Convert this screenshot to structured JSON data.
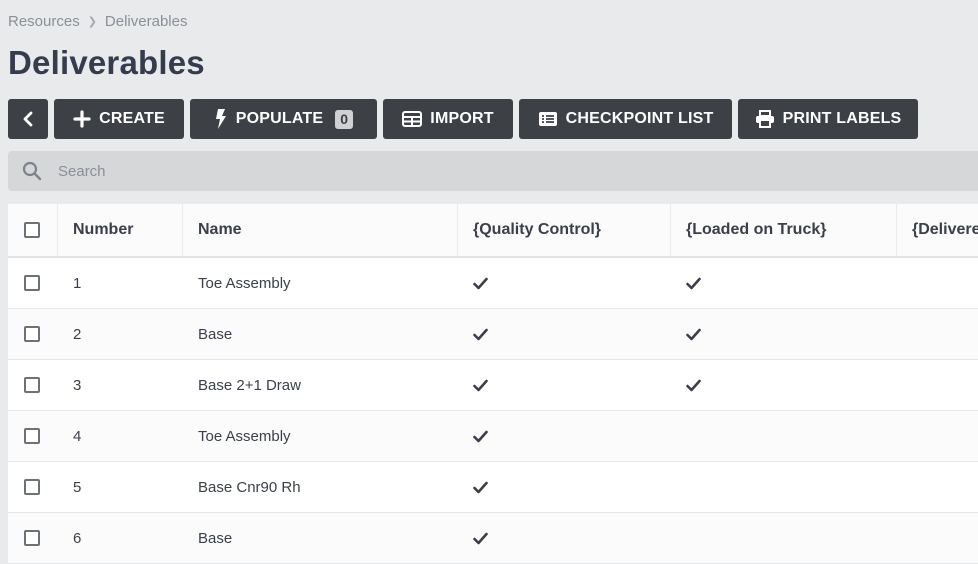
{
  "breadcrumb": {
    "root": "Resources",
    "current": "Deliverables"
  },
  "page_title": "Deliverables",
  "toolbar": {
    "create_label": "CREATE",
    "populate_label": "POPULATE",
    "populate_count": "0",
    "import_label": "IMPORT",
    "checkpoint_label": "CHECKPOINT LIST",
    "print_label": "PRINT LABELS"
  },
  "search": {
    "placeholder": "Search",
    "value": ""
  },
  "table": {
    "headers": {
      "number": "Number",
      "name": "Name",
      "quality_control": "{Quality Control}",
      "loaded_on_truck": "{Loaded on Truck}",
      "delivered": "{Delivere"
    },
    "rows": [
      {
        "number": "1",
        "name": "Toe Assembly",
        "qc": true,
        "truck": true
      },
      {
        "number": "2",
        "name": "Base",
        "qc": true,
        "truck": true
      },
      {
        "number": "3",
        "name": "Base 2+1 Draw",
        "qc": true,
        "truck": true
      },
      {
        "number": "4",
        "name": "Toe Assembly",
        "qc": true,
        "truck": false
      },
      {
        "number": "5",
        "name": "Base Cnr90 Rh",
        "qc": true,
        "truck": false
      },
      {
        "number": "6",
        "name": "Base",
        "qc": true,
        "truck": false
      }
    ]
  },
  "colors": {
    "button_bg": "#3d4146",
    "title": "#353c4e",
    "page_bg": "#e9eaec"
  }
}
